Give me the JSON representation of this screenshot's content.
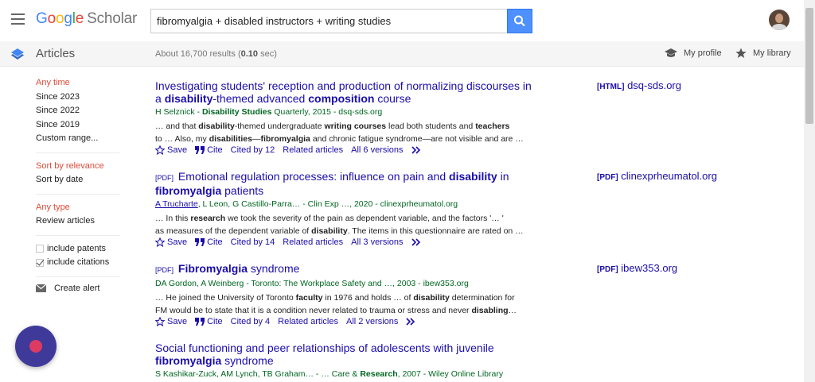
{
  "header": {
    "logo_letters": [
      "G",
      "o",
      "o",
      "g",
      "l",
      "e"
    ],
    "logo_suffix": "Scholar",
    "search_value": "fibromyalgia + disabled instructors + writing studies"
  },
  "subbar": {
    "section_label": "Articles",
    "results_prefix": "About 16,700 results (",
    "results_time": "0.10",
    "results_suffix": " sec)",
    "my_profile": "My profile",
    "my_library": "My library"
  },
  "sidebar": {
    "time_group": [
      "Any time",
      "Since 2023",
      "Since 2022",
      "Since 2019",
      "Custom range..."
    ],
    "sort_group": [
      "Sort by relevance",
      "Sort by date"
    ],
    "type_group": [
      "Any type",
      "Review articles"
    ],
    "include_patents": "include patents",
    "include_citations": "include citations",
    "create_alert": "Create alert"
  },
  "results": [
    {
      "title_a": "Investigating students' reception and production of normalizing discourses in a ",
      "title_b": "disability",
      "title_c": "-themed advanced ",
      "title_d": "composition",
      "title_e": " course",
      "meta_a": "H Selznick - ",
      "meta_b": "Disability Studies",
      "meta_c": " Quarterly, 2015 - dsq-sds.org",
      "snip_1": [
        "… and that ",
        "disability",
        "-themed undergraduate ",
        "writing courses",
        " lead both students and ",
        "teachers"
      ],
      "snip_2": [
        "to … Also, my ",
        "disabilities",
        "—",
        "fibromyalgia",
        " and chronic fatigue syndrome—are not visible and are …"
      ],
      "save": "Save",
      "cite": "Cite",
      "cited_by": "Cited by 12",
      "related": "Related articles",
      "versions": "All 6 versions",
      "side_tag": "[HTML]",
      "side_domain": "dsq-sds.org"
    },
    {
      "tag": "[PDF]",
      "title_a": "Emotional regulation processes: influence on pain and ",
      "title_b": "disability",
      "title_c": " in ",
      "title_d": "fibromyalgia",
      "title_e": " patients",
      "meta_author": "A Trucharte",
      "meta_rest": ", L Leon, G Castillo-Parra… - Clin Exp …, 2020 - clinexprheumatol.org",
      "snip_1": [
        "… In this ",
        "research",
        " we took the severity of the pain as dependent variable, and the factors '… '"
      ],
      "snip_2": [
        "as measures of the dependent variable of ",
        "disability",
        ". The items in this questionnaire are rated on …"
      ],
      "save": "Save",
      "cite": "Cite",
      "cited_by": "Cited by 14",
      "related": "Related articles",
      "versions": "All 3 versions",
      "side_tag": "[PDF]",
      "side_domain": "clinexprheumatol.org"
    },
    {
      "tag": "[PDF]",
      "title_b": "Fibromyalgia",
      "title_c": " syndrome",
      "meta": "DA Gordon, A Weinberg - Toronto: The Workplace Safety and …, 2003 - ibew353.org",
      "snip_1": [
        "… He joined the University of Toronto ",
        "faculty",
        " in 1976 and holds … of ",
        "disability",
        " determination for"
      ],
      "snip_2": [
        "FM would be to state that it is a condition never related to trauma or stress and never ",
        "disabling",
        "…"
      ],
      "save": "Save",
      "cite": "Cite",
      "cited_by": "Cited by 4",
      "related": "Related articles",
      "versions": "All 2 versions",
      "side_tag": "[PDF]",
      "side_domain": "ibew353.org"
    },
    {
      "title_a": "Social functioning and peer relationships of adolescents with juvenile ",
      "title_b": "fibromyalgia",
      "title_c": " syndrome",
      "meta_a": "S Kashikar-Zuck, AM Lynch, TB Graham… - … Care & ",
      "meta_b": "Research",
      "meta_c": ", 2007 - Wiley Online Library"
    }
  ],
  "colors": {
    "link": "#1a0dab",
    "meta_green": "#006621",
    "selected_red": "#dd4b39",
    "search_blue": "#4d90fe",
    "fab": "#3f3a9a"
  }
}
